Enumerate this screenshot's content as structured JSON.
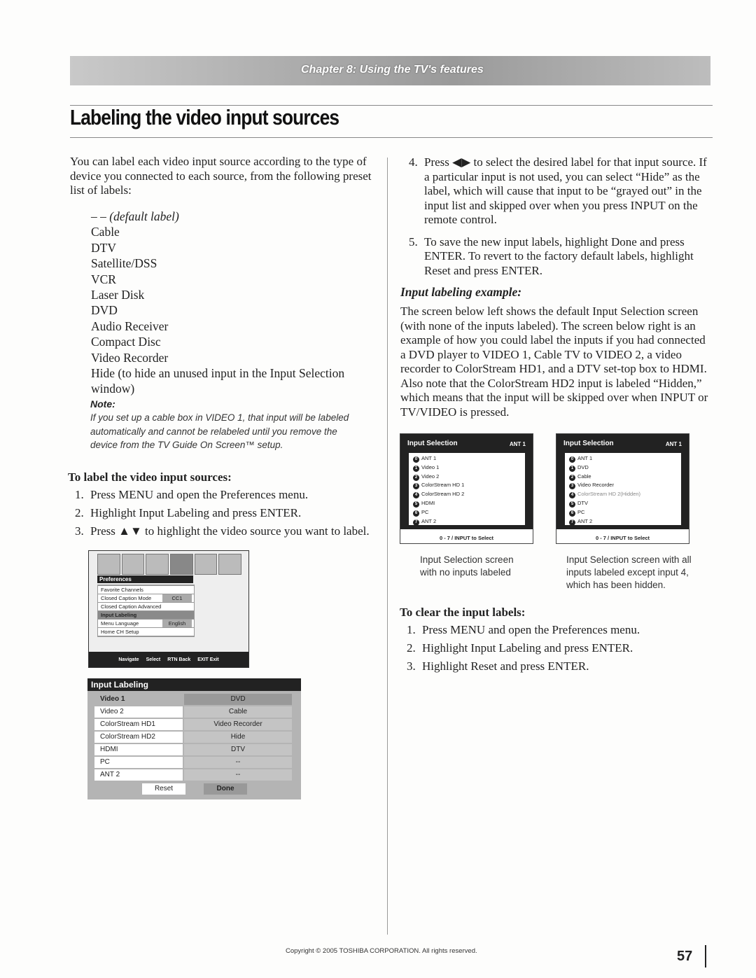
{
  "header": {
    "chapter": "Chapter 8: Using the TV's features",
    "title": "Labeling the video input sources"
  },
  "left": {
    "intro": "You can label each video input source according to the type of device you connected to each source, from the following preset list of labels:",
    "labels": [
      "– – (default label)",
      "Cable",
      "DTV",
      "Satellite/DSS",
      "VCR",
      "Laser Disk",
      "DVD",
      "Audio Receiver",
      "Compact Disc",
      "Video Recorder",
      "Hide (to hide an unused input in the Input Selection window)"
    ],
    "note_heading": "Note:",
    "note": "If you set up a cable box in VIDEO 1, that input will be labeled automatically and cannot be relabeled until you remove the device from the TV Guide On Screen™ setup.",
    "steps_heading": "To label the video input sources:",
    "steps": [
      {
        "n": "1.",
        "t": "Press MENU and open the Preferences menu."
      },
      {
        "n": "2.",
        "t": "Highlight Input Labeling and press ENTER."
      },
      {
        "n": "3.",
        "t": "Press ▲▼ to highlight the video source you want to label."
      }
    ]
  },
  "prefs_screen": {
    "title": "Preferences",
    "items": [
      {
        "label": "Favorite Channels"
      },
      {
        "label": "Closed Caption Mode",
        "value": "CC1"
      },
      {
        "label": "Closed Caption Advanced"
      },
      {
        "label": "Input Labeling",
        "highlight": true
      },
      {
        "label": "Menu Language",
        "value": "English"
      },
      {
        "label": "Home CH Setup"
      }
    ],
    "footer": [
      "Navigate",
      "Select",
      "RTN Back",
      "EXIT Exit"
    ]
  },
  "labeling_screen": {
    "title": "Input Labeling",
    "rows": [
      {
        "input": "Video 1",
        "label": "DVD"
      },
      {
        "input": "Video 2",
        "label": "Cable"
      },
      {
        "input": "ColorStream HD1",
        "label": "Video Recorder"
      },
      {
        "input": "ColorStream HD2",
        "label": "Hide"
      },
      {
        "input": "HDMI",
        "label": "DTV"
      },
      {
        "input": "PC",
        "label": "--"
      },
      {
        "input": "ANT 2",
        "label": "--"
      }
    ],
    "reset": "Reset",
    "done": "Done"
  },
  "right": {
    "steps": [
      {
        "n": "4.",
        "t": "Press ◀▶ to select the desired label for that input source. If a particular input is not used, you can select “Hide” as the label, which will cause that input to be “grayed out” in the input list and skipped over when you press INPUT on the remote control."
      },
      {
        "n": "5.",
        "t": "To save the new input labels, highlight Done and press ENTER. To revert to the factory default labels, highlight Reset and press ENTER."
      }
    ],
    "example_heading": "Input labeling example:",
    "example_text": "The screen below left shows the default Input Selection screen (with none of the inputs labeled). The screen below right is an example of how you could label the inputs if you had connected a DVD player to VIDEO 1, Cable TV to VIDEO 2, a video recorder to ColorStream HD1, and a DTV set-top box to HDMI. Also note that the ColorStream HD2 input is labeled “Hidden,” which means that the input will be skipped over when INPUT or TV/VIDEO is pressed.",
    "screens": [
      {
        "title": "Input Selection",
        "ant": "ANT 1",
        "items": [
          "ANT 1",
          "Video 1",
          "Video 2",
          "ColorStream HD 1",
          "ColorStream HD 2",
          "HDMI",
          "PC",
          "ANT 2"
        ],
        "footer": "0 - 7 / INPUT to Select",
        "caption": "Input Selection screen with no inputs labeled"
      },
      {
        "title": "Input Selection",
        "ant": "ANT 1",
        "items": [
          "ANT 1",
          "DVD",
          "Cable",
          "Video Recorder",
          "ColorStream HD 2(Hidden)",
          "DTV",
          "PC",
          "ANT 2"
        ],
        "footer": "0 - 7 / INPUT to Select",
        "caption": "Input Selection screen with all inputs labeled except input 4, which has been hidden."
      }
    ],
    "clear_heading": "To clear the input labels:",
    "clear_steps": [
      {
        "n": "1.",
        "t": "Press MENU and open the Preferences menu."
      },
      {
        "n": "2.",
        "t": "Highlight Input Labeling and press ENTER."
      },
      {
        "n": "3.",
        "t": "Highlight Reset and press ENTER."
      }
    ]
  },
  "footer": {
    "copyright": "Copyright © 2005 TOSHIBA CORPORATION. All rights reserved.",
    "page": "57"
  }
}
